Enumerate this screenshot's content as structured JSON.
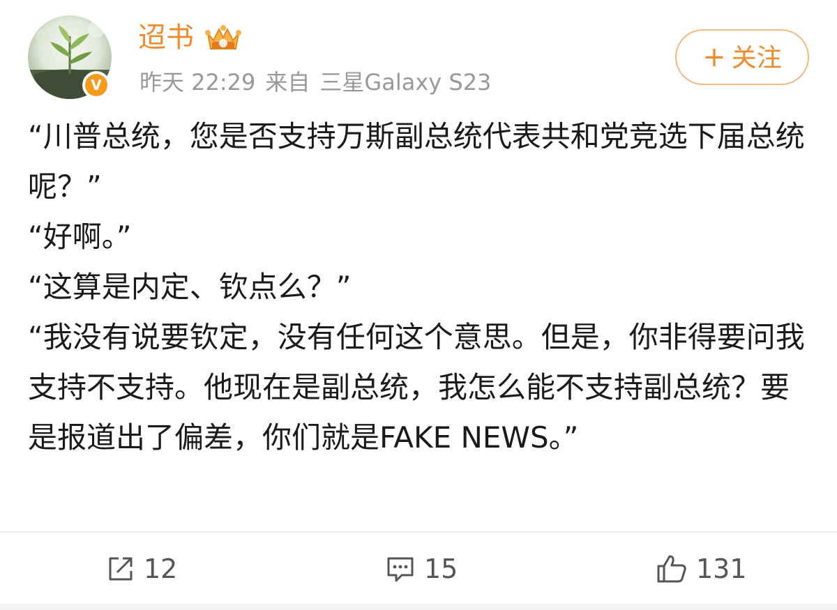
{
  "post": {
    "author": {
      "name": "迢书",
      "crown_icon": "vip-crown-icon",
      "verified_icon": "verified-v-icon",
      "verified_mark": "V"
    },
    "meta": {
      "time": "昨天 22:29",
      "source_prefix": "来自",
      "device": "三星Galaxy S23"
    },
    "follow_button": {
      "plus": "+",
      "label": "关注"
    },
    "paragraphs": [
      "“川普总统，您是否支持万斯副总统代表共和党竞选下届总统呢？”",
      "“好啊。”",
      "“这算是内定、钦点么？”",
      "“我没有说要钦定，没有任何这个意思。但是，你非得要问我支持不支持。他现在是副总统，我怎么能不支持副总统？要是报道出了偏差，你们就是FAKE NEWS。”"
    ]
  },
  "actions": {
    "repost": {
      "icon": "repost-icon",
      "count": "12"
    },
    "comment": {
      "icon": "comment-icon",
      "count": "15"
    },
    "like": {
      "icon": "thumbs-up-icon",
      "count": "131"
    }
  },
  "colors": {
    "accent": "#f08a2b",
    "meta_text": "#999999",
    "body_text": "#1a1a1a",
    "verified_badge": "#f59b1c"
  }
}
